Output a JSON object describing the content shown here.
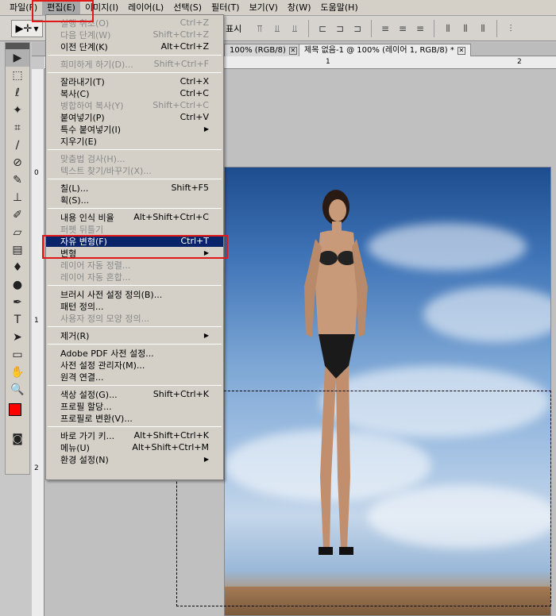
{
  "menubar": {
    "items": [
      "파일(F)",
      "편집(E)",
      "이미지(I)",
      "레이어(L)",
      "선택(S)",
      "필터(T)",
      "보기(V)",
      "창(W)",
      "도움말(H)"
    ],
    "active_index": 1
  },
  "optbar": {
    "visible_text": "표시"
  },
  "tabs": [
    {
      "label": "100% (RGB/8)"
    },
    {
      "label": "제목 없음-1 @ 100% (레이어 1, RGB/8) *"
    }
  ],
  "ruler": {
    "top_marks": [
      "1",
      "2"
    ],
    "left_marks": [
      "0",
      "1",
      "2"
    ]
  },
  "edit_menu": {
    "groups": [
      [
        {
          "label": "실행 취소(O)",
          "shortcut": "Ctrl+Z",
          "disabled": true
        },
        {
          "label": "다음 단계(W)",
          "shortcut": "Shift+Ctrl+Z",
          "disabled": true
        },
        {
          "label": "이전 단계(K)",
          "shortcut": "Alt+Ctrl+Z",
          "disabled": false
        }
      ],
      [
        {
          "label": "희미하게 하기(D)...",
          "shortcut": "Shift+Ctrl+F",
          "disabled": true
        }
      ],
      [
        {
          "label": "잘라내기(T)",
          "shortcut": "Ctrl+X",
          "disabled": false
        },
        {
          "label": "복사(C)",
          "shortcut": "Ctrl+C",
          "disabled": false
        },
        {
          "label": "병합하여 복사(Y)",
          "shortcut": "Shift+Ctrl+C",
          "disabled": true
        },
        {
          "label": "붙여넣기(P)",
          "shortcut": "Ctrl+V",
          "disabled": false
        },
        {
          "label": "특수 붙여넣기(I)",
          "shortcut": "",
          "disabled": false,
          "submenu": true
        },
        {
          "label": "지우기(E)",
          "shortcut": "",
          "disabled": false
        }
      ],
      [
        {
          "label": "맞춤법 검사(H)...",
          "shortcut": "",
          "disabled": true
        },
        {
          "label": "텍스트 찾기/바꾸기(X)...",
          "shortcut": "",
          "disabled": true
        }
      ],
      [
        {
          "label": "칠(L)...",
          "shortcut": "Shift+F5",
          "disabled": false
        },
        {
          "label": "획(S)...",
          "shortcut": "",
          "disabled": false
        }
      ],
      [
        {
          "label": "내용 인식 비율",
          "shortcut": "Alt+Shift+Ctrl+C",
          "disabled": false
        },
        {
          "label": "퍼펫 뒤틀기",
          "shortcut": "",
          "disabled": true
        },
        {
          "label": "자유 변형(F)",
          "shortcut": "Ctrl+T",
          "disabled": false,
          "highlighted": true
        },
        {
          "label": "변형",
          "shortcut": "",
          "disabled": false,
          "submenu": true
        },
        {
          "label": "레이어 자동 정렬...",
          "shortcut": "",
          "disabled": true
        },
        {
          "label": "레이어 자동 혼합...",
          "shortcut": "",
          "disabled": true
        }
      ],
      [
        {
          "label": "브러시 사전 설정 정의(B)...",
          "shortcut": "",
          "disabled": false
        },
        {
          "label": "패턴 정의...",
          "shortcut": "",
          "disabled": false
        },
        {
          "label": "사용자 정의 모양 정의...",
          "shortcut": "",
          "disabled": true
        }
      ],
      [
        {
          "label": "제거(R)",
          "shortcut": "",
          "disabled": false,
          "submenu": true
        }
      ],
      [
        {
          "label": "Adobe PDF 사전 설정...",
          "shortcut": "",
          "disabled": false
        },
        {
          "label": "사전 설정 관리자(M)...",
          "shortcut": "",
          "disabled": false
        },
        {
          "label": "원격 연결...",
          "shortcut": "",
          "disabled": false
        }
      ],
      [
        {
          "label": "색상 설정(G)...",
          "shortcut": "Shift+Ctrl+K",
          "disabled": false
        },
        {
          "label": "프로필 할당...",
          "shortcut": "",
          "disabled": false
        },
        {
          "label": "프로필로 변환(V)...",
          "shortcut": "",
          "disabled": false
        }
      ],
      [
        {
          "label": "바로 가기 키...",
          "shortcut": "Alt+Shift+Ctrl+K",
          "disabled": false
        },
        {
          "label": "메뉴(U)",
          "shortcut": "Alt+Shift+Ctrl+M",
          "disabled": false
        },
        {
          "label": "환경 설정(N)",
          "shortcut": "",
          "disabled": false,
          "submenu": true
        }
      ]
    ]
  },
  "colors": {
    "foreground": "#ff0000",
    "background": "#ffffff",
    "highlight": "#0a246a",
    "annotation_box": "#e01818"
  },
  "toolbox_icons": [
    "move-icon",
    "marquee-icon",
    "lasso-icon",
    "quick-select-icon",
    "crop-icon",
    "eyedropper-icon",
    "spot-heal-icon",
    "brush-icon",
    "clone-stamp-icon",
    "history-brush-icon",
    "eraser-icon",
    "gradient-icon",
    "blur-icon",
    "dodge-icon",
    "pen-icon",
    "type-icon",
    "path-select-icon",
    "rectangle-icon",
    "hand-icon",
    "zoom-icon"
  ]
}
